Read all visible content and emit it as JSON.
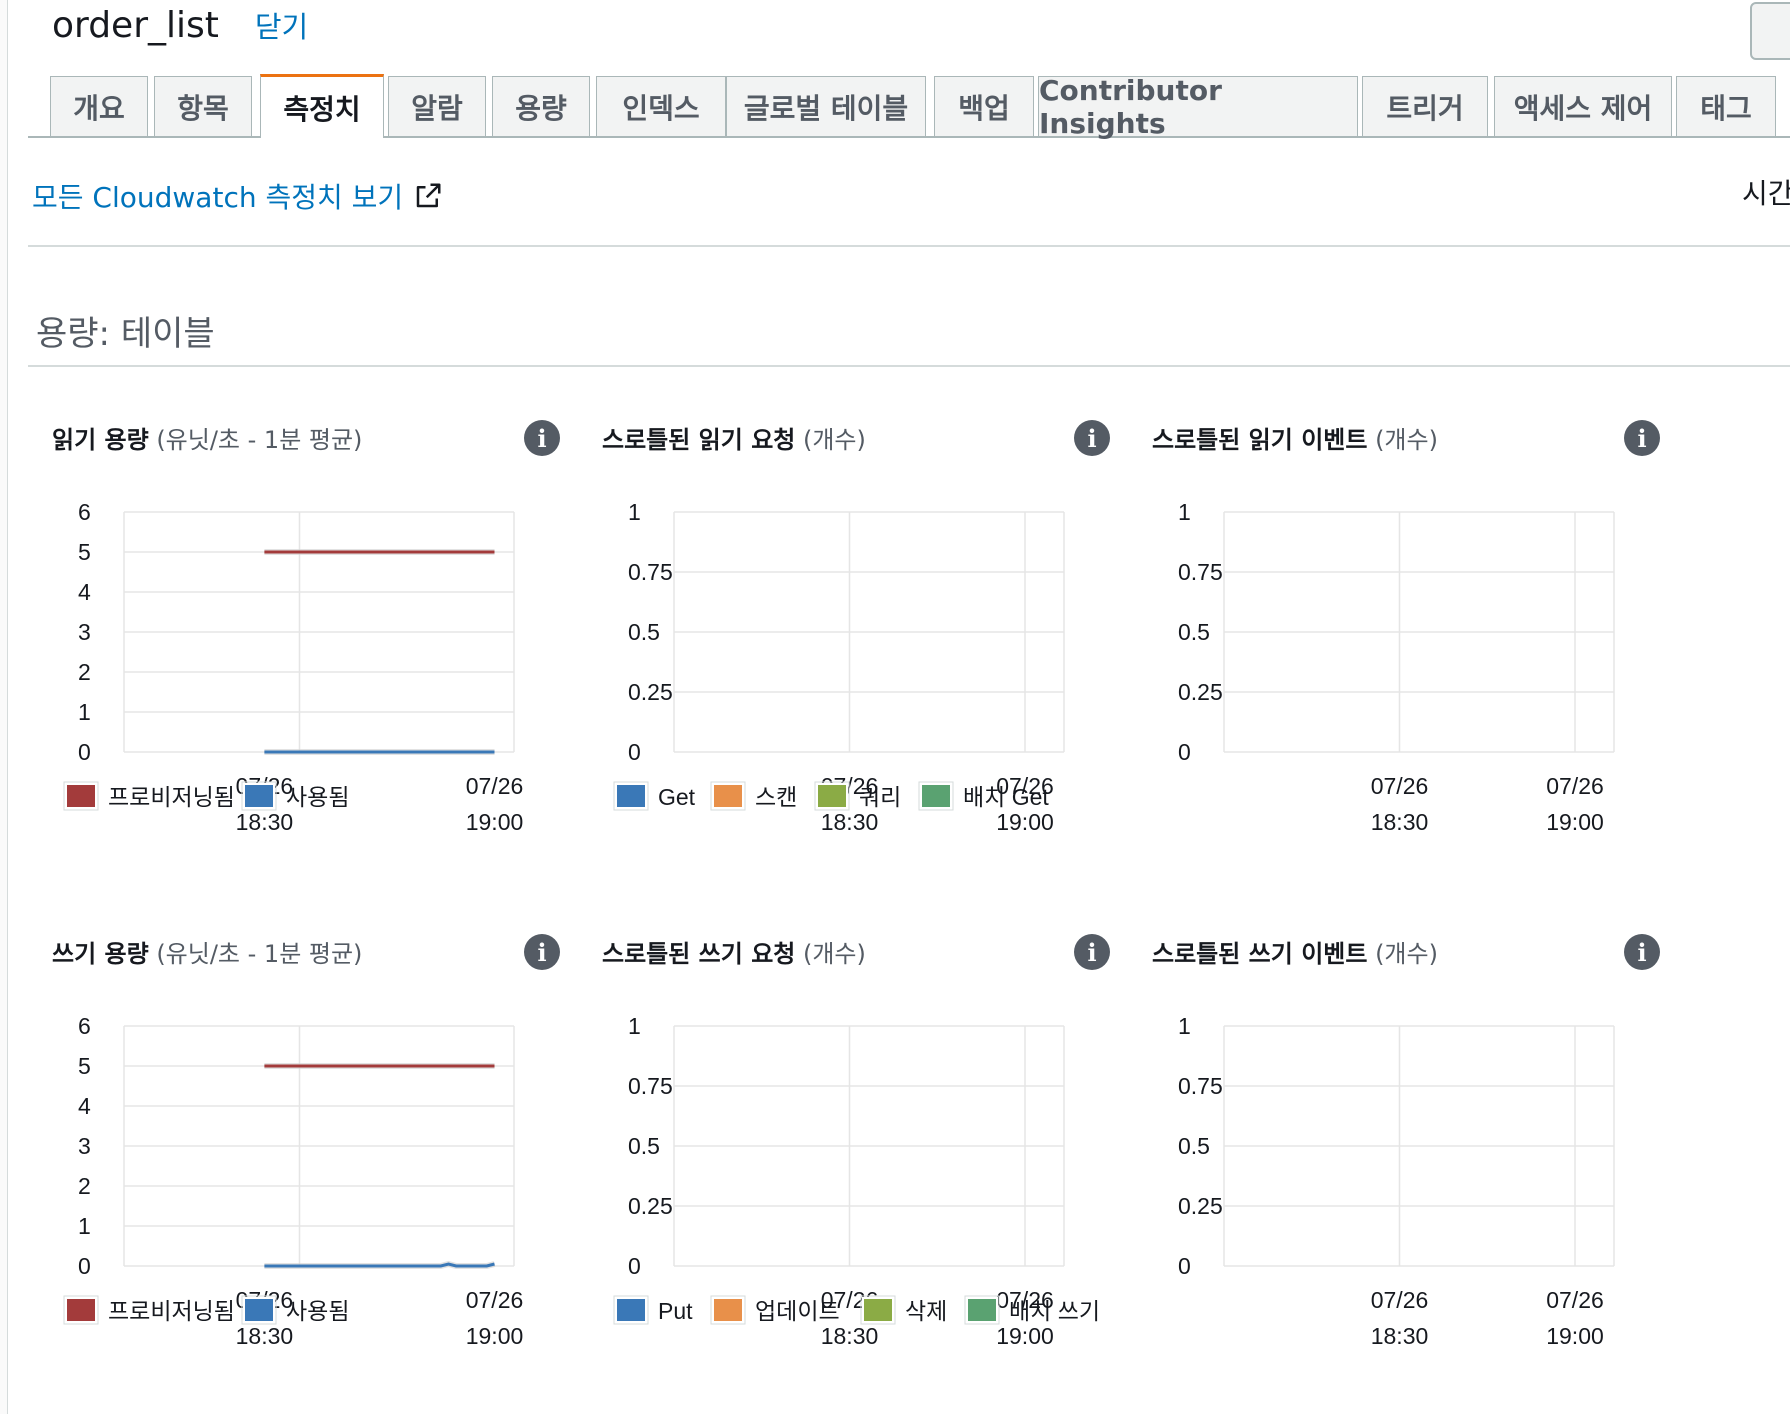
{
  "header": {
    "title": "order_list",
    "close_label": "닫기"
  },
  "tabs": [
    {
      "label": "개요",
      "active": false
    },
    {
      "label": "항목",
      "active": false
    },
    {
      "label": "측정치",
      "active": true
    },
    {
      "label": "알람",
      "active": false
    },
    {
      "label": "용량",
      "active": false
    },
    {
      "label": "인덱스",
      "active": false
    },
    {
      "label": "글로벌 테이블",
      "active": false
    },
    {
      "label": "백업",
      "active": false
    },
    {
      "label": "Contributor Insights",
      "active": false
    },
    {
      "label": "트리거",
      "active": false
    },
    {
      "label": "액세스 제어",
      "active": false
    },
    {
      "label": "태그",
      "active": false
    }
  ],
  "cloudwatch_link": "모든 Cloudwatch 측정치 보기",
  "time_label": "시간",
  "section_title": "용량: 테이블",
  "colors": {
    "provisioned": "#a33b3b",
    "consumed": "#3a78b7",
    "orange": "#e8904a",
    "olive": "#8bab45",
    "green": "#5aa271",
    "link": "#0073bb",
    "active_tab": "#ec7211",
    "grid": "#e5e5e5"
  },
  "widgets": [
    {
      "title": "읽기 용량",
      "subtitle": "(유닛/초 - 1분 평균)"
    },
    {
      "title": "스로틀된 읽기 요청",
      "subtitle": "(개수)"
    },
    {
      "title": "스로틀된 읽기 이벤트",
      "subtitle": "(개수)"
    },
    {
      "title": "쓰기 용량",
      "subtitle": "(유닛/초 - 1분 평균)"
    },
    {
      "title": "스로틀된 쓰기 요청",
      "subtitle": "(개수)"
    },
    {
      "title": "스로틀된 쓰기 이벤트",
      "subtitle": "(개수)"
    }
  ],
  "chart_data": [
    {
      "type": "line",
      "ylim": [
        0,
        6
      ],
      "yticks": [
        "6",
        "5",
        "4",
        "3",
        "2",
        "1",
        "0"
      ],
      "xticks": [
        [
          "07/26",
          "18:30"
        ],
        [
          "07/26",
          "19:00"
        ]
      ],
      "x_start": "18:22",
      "x_end": "19:05",
      "series": [
        {
          "name": "프로비저닝됨",
          "color": "provisioned",
          "points": [
            [
              "18:30",
              5
            ],
            [
              "19:00",
              5
            ]
          ]
        },
        {
          "name": "사용됨",
          "color": "consumed",
          "points": [
            [
              "18:30",
              0
            ],
            [
              "19:00",
              0
            ]
          ]
        }
      ],
      "legend": [
        {
          "label": "프로비저닝됨",
          "color": "provisioned"
        },
        {
          "label": "사용됨",
          "color": "consumed"
        }
      ]
    },
    {
      "type": "line",
      "ylim": [
        0,
        1
      ],
      "yticks": [
        "1",
        "0.75",
        "0.5",
        "0.25",
        "0"
      ],
      "xticks": [
        [
          "07/26",
          "18:30"
        ],
        [
          "07/26",
          "19:00"
        ]
      ],
      "series": [],
      "legend": [
        {
          "label": "Get",
          "color": "consumed"
        },
        {
          "label": "스캔",
          "color": "orange"
        },
        {
          "label": "쿼리",
          "color": "olive"
        },
        {
          "label": "배치 Get",
          "color": "green"
        }
      ]
    },
    {
      "type": "line",
      "ylim": [
        0,
        1
      ],
      "yticks": [
        "1",
        "0.75",
        "0.5",
        "0.25",
        "0"
      ],
      "xticks": [
        [
          "07/26",
          "18:30"
        ],
        [
          "07/26",
          "19:00"
        ]
      ],
      "series": [],
      "legend": []
    },
    {
      "type": "line",
      "ylim": [
        0,
        6
      ],
      "yticks": [
        "6",
        "5",
        "4",
        "3",
        "2",
        "1",
        "0"
      ],
      "xticks": [
        [
          "07/26",
          "18:30"
        ],
        [
          "07/26",
          "19:00"
        ]
      ],
      "series": [
        {
          "name": "프로비저닝됨",
          "color": "provisioned",
          "points": [
            [
              "18:30",
              5
            ],
            [
              "19:00",
              5
            ]
          ]
        },
        {
          "name": "사용됨",
          "color": "consumed",
          "points": [
            [
              "18:30",
              0
            ],
            [
              "18:53",
              0
            ],
            [
              "18:54",
              0.05
            ],
            [
              "18:55",
              0
            ],
            [
              "18:59",
              0
            ],
            [
              "19:00",
              0.05
            ]
          ]
        }
      ],
      "legend": [
        {
          "label": "프로비저닝됨",
          "color": "provisioned"
        },
        {
          "label": "사용됨",
          "color": "consumed"
        }
      ]
    },
    {
      "type": "line",
      "ylim": [
        0,
        1
      ],
      "yticks": [
        "1",
        "0.75",
        "0.5",
        "0.25",
        "0"
      ],
      "xticks": [
        [
          "07/26",
          "18:30"
        ],
        [
          "07/26",
          "19:00"
        ]
      ],
      "series": [],
      "legend": [
        {
          "label": "Put",
          "color": "consumed"
        },
        {
          "label": "업데이트",
          "color": "orange"
        },
        {
          "label": "삭제",
          "color": "olive"
        },
        {
          "label": "배치 쓰기",
          "color": "green"
        }
      ]
    },
    {
      "type": "line",
      "ylim": [
        0,
        1
      ],
      "yticks": [
        "1",
        "0.75",
        "0.5",
        "0.25",
        "0"
      ],
      "xticks": [
        [
          "07/26",
          "18:30"
        ],
        [
          "07/26",
          "19:00"
        ]
      ],
      "series": [],
      "legend": []
    }
  ]
}
